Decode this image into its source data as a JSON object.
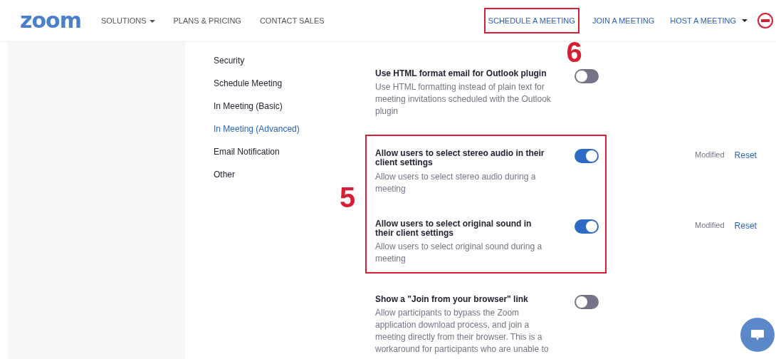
{
  "header": {
    "logo": "zoom",
    "nav_left": [
      {
        "label": "SOLUTIONS",
        "dropdown": true
      },
      {
        "label": "PLANS & PRICING",
        "dropdown": false
      },
      {
        "label": "CONTACT SALES",
        "dropdown": false
      }
    ],
    "nav_right": [
      {
        "label": "SCHEDULE A MEETING",
        "dropdown": false,
        "callout": "6"
      },
      {
        "label": "JOIN A MEETING",
        "dropdown": false
      },
      {
        "label": "HOST A MEETING",
        "dropdown": true
      }
    ]
  },
  "sidebar": {
    "items": [
      {
        "label": "Security",
        "selected": false
      },
      {
        "label": "Schedule Meeting",
        "selected": false
      },
      {
        "label": "In Meeting (Basic)",
        "selected": false
      },
      {
        "label": "In Meeting (Advanced)",
        "selected": true
      },
      {
        "label": "Email Notification",
        "selected": false
      },
      {
        "label": "Other",
        "selected": false
      }
    ]
  },
  "setting_groups": [
    {
      "settings": [
        {
          "title": "Use HTML format email for Outlook plugin",
          "description": "Use HTML formatting instead of plain text for meeting invitations scheduled with the Outlook plugin",
          "on": false
        }
      ]
    },
    {
      "callout": "5",
      "settings": [
        {
          "title": "Allow users to select stereo audio in their client settings",
          "description": "Allow users to select stereo audio during a meeting",
          "on": true,
          "status": "Modified",
          "action": "Reset"
        },
        {
          "title": "Allow users to select original sound in their client settings",
          "description": "Allow users to select original sound during a meeting",
          "on": true,
          "status": "Modified",
          "action": "Reset"
        }
      ]
    },
    {
      "settings": [
        {
          "title": "Show a \"Join from your browser\" link",
          "description": "Allow participants to bypass the Zoom application download process, and join a meeting directly from their browser. This is a workaround for participants who are unable to",
          "on": false
        }
      ]
    }
  ]
}
